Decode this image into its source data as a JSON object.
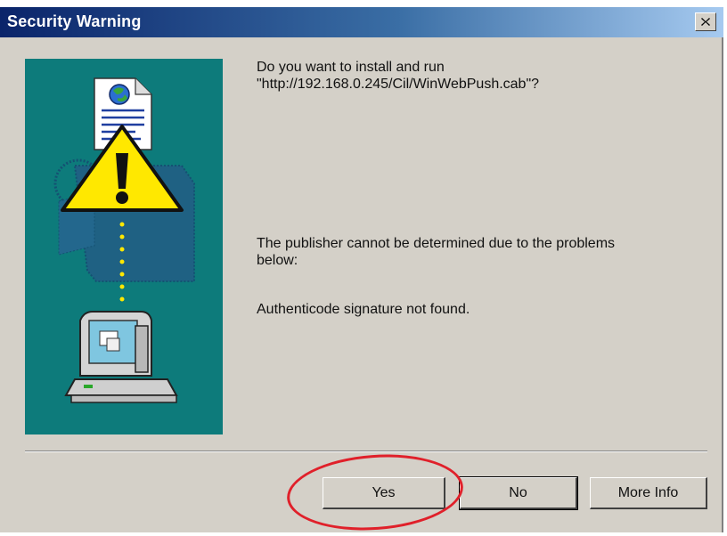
{
  "window": {
    "title": "Security Warning",
    "close_icon": "close-x-icon"
  },
  "message": {
    "question_line1": "Do you want to install and run",
    "question_line2": "\"http://192.168.0.245/Cil/WinWebPush.cab\"?",
    "publisher_line1": "The publisher cannot be determined due to the problems",
    "publisher_line2": "below:",
    "authenticode": "Authenticode signature not found."
  },
  "buttons": {
    "yes": "Yes",
    "no": "No",
    "more_info": "More Info"
  },
  "art": {
    "background_color": "#0d7b7b",
    "icons": [
      "document-globe-icon",
      "warning-exclamation-icon",
      "computer-icon"
    ]
  },
  "annotation": {
    "color": "#e0202a",
    "target": "yes-button"
  }
}
